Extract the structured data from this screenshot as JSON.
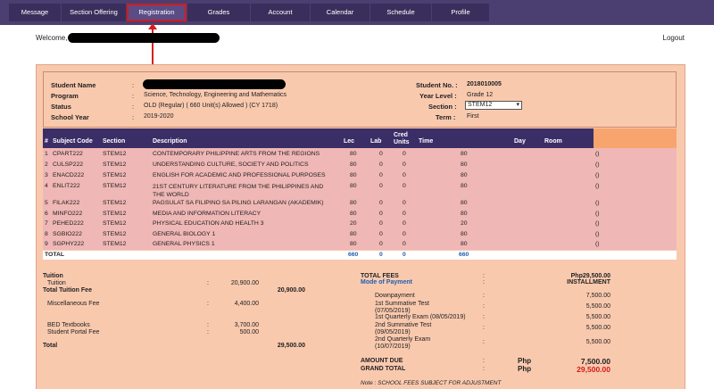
{
  "nav": [
    "Message",
    "Section Offering",
    "Registration",
    "Grades",
    "Account",
    "Calendar",
    "Schedule",
    "Profile"
  ],
  "header": {
    "welcome": "Welcome,",
    "logout": "Logout"
  },
  "student": {
    "name_label": "Student Name",
    "program_label": "Program",
    "status_label": "Status",
    "school_year_label": "School Year",
    "program": "Science, Technology, Engineering and Mathematics",
    "status": "OLD (Regular) ( 660 Unit(s) Allowed ) (CY 1718)",
    "school_year": "2019-2020",
    "no_label": "Student No. :",
    "no": "2018010005",
    "level_label": "Year Level :",
    "level": "Grade 12",
    "section_label": "Section :",
    "section": "STEM12",
    "term_label": "Term :",
    "term": "First"
  },
  "table": {
    "headers": [
      "#",
      "Subject Code",
      "Section",
      "Description",
      "Lec",
      "Lab",
      "Cred\nUnits",
      "Time",
      "Day",
      "Room"
    ],
    "rows": [
      {
        "n": "1",
        "code": "CPART222",
        "section": "STEM12",
        "desc": "CONTEMPORARY PHILIPPINE ARTS FROM THE REGIONS",
        "lec": "80",
        "lab": "0",
        "cred": "0",
        "time": "80",
        "room": "()"
      },
      {
        "n": "2",
        "code": "CULSP222",
        "section": "STEM12",
        "desc": "UNDERSTANDING CULTURE, SOCIETY AND POLITICS",
        "lec": "80",
        "lab": "0",
        "cred": "0",
        "time": "80",
        "room": "()"
      },
      {
        "n": "3",
        "code": "ENACD222",
        "section": "STEM12",
        "desc": "ENGLISH FOR ACADEMIC AND PROFESSIONAL PURPOSES",
        "lec": "80",
        "lab": "0",
        "cred": "0",
        "time": "80",
        "room": "()"
      },
      {
        "n": "4",
        "code": "ENLIT222",
        "section": "STEM12",
        "desc": "21ST CENTURY LITERATURE FROM THE PHILIPPINES AND THE WORLD",
        "lec": "80",
        "lab": "0",
        "cred": "0",
        "time": "80",
        "room": "()"
      },
      {
        "n": "5",
        "code": "FILAK222",
        "section": "STEM12",
        "desc": "PAGSULAT SA FILIPINO SA PILING LARANGAN (AKADEMIK)",
        "lec": "80",
        "lab": "0",
        "cred": "0",
        "time": "80",
        "room": "()"
      },
      {
        "n": "6",
        "code": "MINFO222",
        "section": "STEM12",
        "desc": "MEDIA AND INFORMATION LITERACY",
        "lec": "80",
        "lab": "0",
        "cred": "0",
        "time": "80",
        "room": "()"
      },
      {
        "n": "7",
        "code": "PEHED222",
        "section": "STEM12",
        "desc": "PHYSICAL EDUCATION AND HEALTH 3",
        "lec": "20",
        "lab": "0",
        "cred": "0",
        "time": "20",
        "room": "()"
      },
      {
        "n": "8",
        "code": "SGBIO222",
        "section": "STEM12",
        "desc": "GENERAL BIOLOGY 1",
        "lec": "80",
        "lab": "0",
        "cred": "0",
        "time": "80",
        "room": "()"
      },
      {
        "n": "9",
        "code": "SGPHY222",
        "section": "STEM12",
        "desc": "GENERAL PHYSICS 1",
        "lec": "80",
        "lab": "0",
        "cred": "0",
        "time": "80",
        "room": "()"
      }
    ],
    "total": {
      "label": "TOTAL",
      "lec": "660",
      "lab": "0",
      "cred": "0",
      "time": "660"
    }
  },
  "fees": {
    "tuition_head": "Tuition",
    "tuition_label": "Tuition",
    "tuition": "20,900.00",
    "total_tuition_label": "Total Tuition Fee",
    "total_tuition": "20,900.00",
    "misc_label": "Miscellaneous Fee",
    "misc": "4,400.00",
    "textbooks_label": "BED Textbooks",
    "textbooks": "3,700.00",
    "portal_label": "Student Portal Fee",
    "portal": "500.00",
    "total_label": "Total",
    "total": "29,500.00",
    "colon": ":"
  },
  "payment": {
    "total_fees_label": "TOTAL FEES",
    "total_fees": "Php29,500.00",
    "mode_label": "Mode of Payment",
    "mode": "INSTALLMENT",
    "schedule": [
      {
        "label": "Downpayment",
        "amount": "7,500.00"
      },
      {
        "label": "1st Summative Test\n(07/05/2019)",
        "amount": "5,500.00"
      },
      {
        "label": "1st Quarterly Exam (08/05/2019)",
        "amount": "5,500.00"
      },
      {
        "label": "2nd Summative Test\n(09/05/2019)",
        "amount": "5,500.00"
      },
      {
        "label": "2nd Quarterly Exam\n(10/07/2019)",
        "amount": "5,500.00"
      }
    ],
    "amount_due_label": "AMOUNT DUE",
    "currency": "Php",
    "amount_due": "7,500.00",
    "grand_total_label": "GRAND TOTAL",
    "grand_total": "29,500.00",
    "note": "Note : SCHOOL FEES SUBJECT FOR ADJUSTMENT"
  },
  "colors": {
    "nav_bg": "#4b3f72",
    "panel_bg": "#f9c9ae",
    "table_head": "#3b2e67",
    "row_bg": "#efb7b5",
    "highlight": "#d61a1a"
  }
}
